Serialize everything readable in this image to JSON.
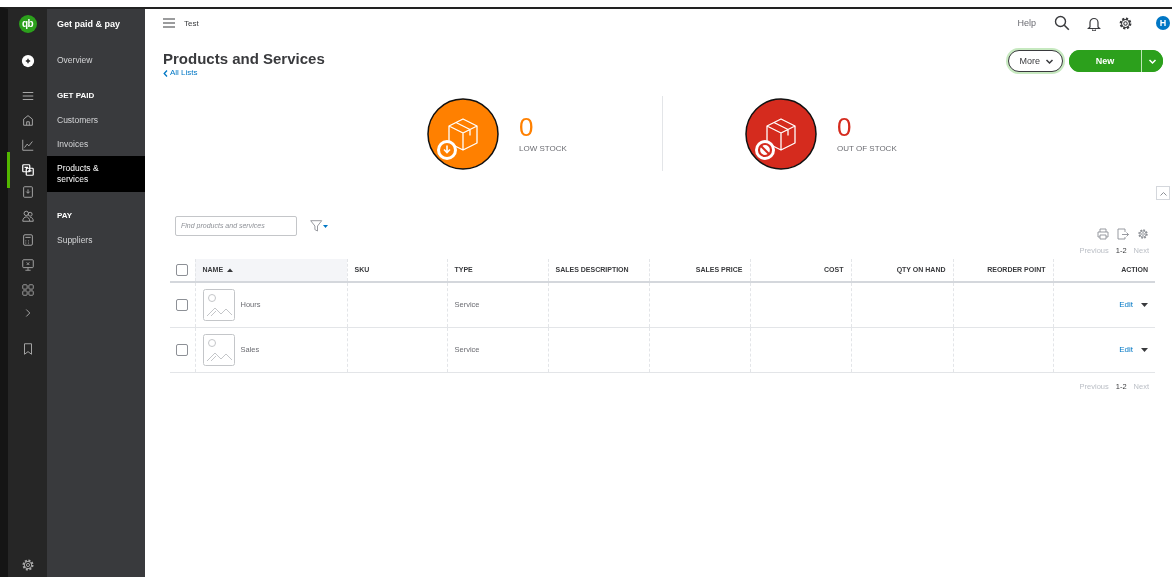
{
  "rail_items": [
    {
      "kind": "logo",
      "label": "qb",
      "selected": false
    },
    {
      "kind": "create",
      "selected": false
    },
    {
      "kind": "menu",
      "selected": false
    },
    {
      "kind": "home",
      "selected": false
    },
    {
      "kind": "chart",
      "selected": false
    },
    {
      "kind": "products",
      "selected": true
    },
    {
      "kind": "document",
      "selected": false
    },
    {
      "kind": "people",
      "selected": false
    },
    {
      "kind": "calculator",
      "selected": false
    },
    {
      "kind": "monitor",
      "selected": false
    },
    {
      "kind": "grid",
      "selected": false
    },
    {
      "kind": "chevron",
      "selected": false
    },
    {
      "kind": "bookmark",
      "selected": false
    },
    {
      "kind": "settings",
      "selected": false
    }
  ],
  "nav": {
    "title": "Get paid & pay",
    "items": [
      {
        "kind": "link",
        "label": "Overview",
        "selected": false
      },
      {
        "kind": "heading",
        "label": "GET PAID"
      },
      {
        "kind": "link",
        "label": "Customers",
        "selected": false
      },
      {
        "kind": "link",
        "label": "Invoices",
        "selected": false
      },
      {
        "kind": "link",
        "label": "Products & services",
        "selected": true
      },
      {
        "kind": "heading",
        "label": "PAY"
      },
      {
        "kind": "link",
        "label": "Suppliers",
        "selected": false
      }
    ]
  },
  "top_bar": {
    "company": "Test",
    "help": "Help",
    "avatar_initial": "H"
  },
  "page": {
    "title": "Products and Services",
    "back_link": "All Lists",
    "more_button": "More",
    "new_button": "New"
  },
  "stats": [
    {
      "kind": "low",
      "value": "0",
      "label": "LOW STOCK",
      "color": "#ff8000"
    },
    {
      "kind": "out",
      "value": "0",
      "label": "OUT OF STOCK",
      "color": "#d52b1e"
    }
  ],
  "search": {
    "placeholder": "Find products and services"
  },
  "pagination_top": {
    "previous": "Previous",
    "range": "1-2",
    "next": "Next",
    "previous_disabled": true,
    "next_disabled": true
  },
  "table": {
    "select_all": {
      "checked": false
    },
    "columns": [
      {
        "label": "NAME",
        "sorted": true
      },
      {
        "label": "SKU",
        "sorted": false
      },
      {
        "label": "TYPE",
        "sorted": false
      },
      {
        "label": "SALES DESCRIPTION",
        "sorted": false
      },
      {
        "label": "SALES PRICE",
        "sorted": false
      },
      {
        "label": "COST",
        "sorted": false
      },
      {
        "label": "QTY ON HAND",
        "sorted": false
      },
      {
        "label": "REORDER POINT",
        "sorted": false
      },
      {
        "label": "ACTION",
        "sorted": false
      }
    ],
    "rows": [
      {
        "checked": false,
        "name": "Hours",
        "type": "Service",
        "action": "Edit"
      },
      {
        "checked": false,
        "name": "Sales",
        "type": "Service",
        "action": "Edit"
      }
    ]
  },
  "pagination_bottom": {
    "previous": "Previous",
    "range": "1-2",
    "next": "Next",
    "previous_disabled": true,
    "next_disabled": true
  }
}
